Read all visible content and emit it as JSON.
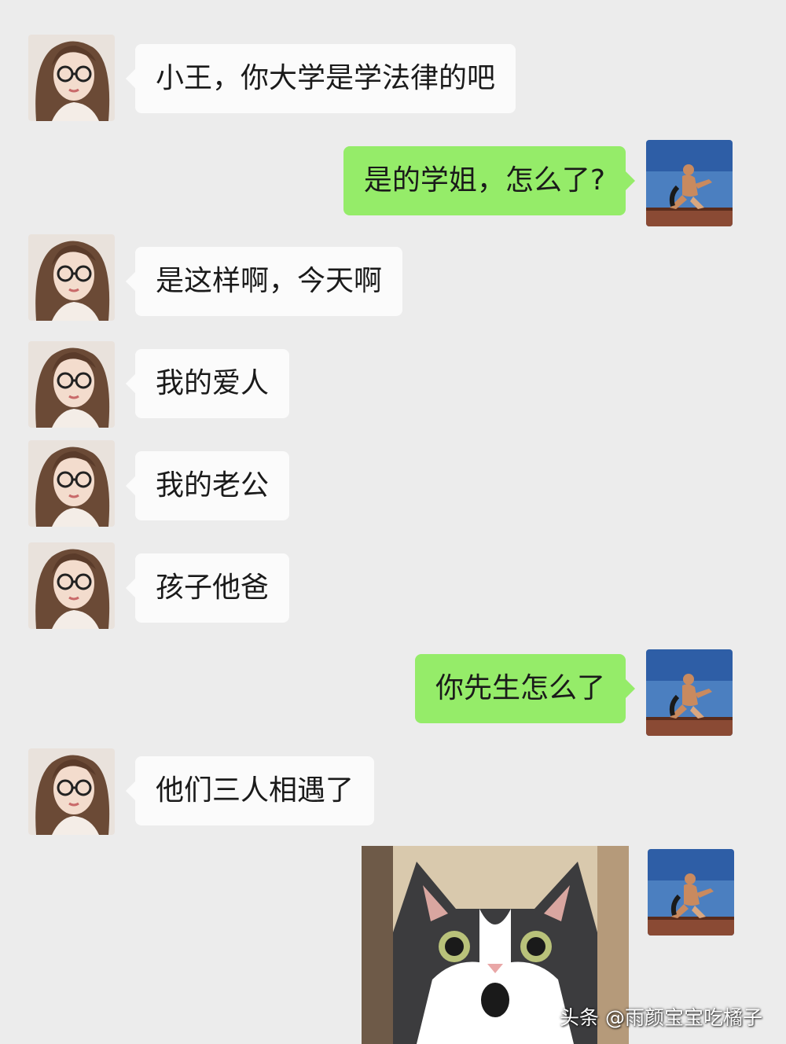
{
  "messages": [
    {
      "side": "in",
      "text": "小王，你大学是学法律的吧"
    },
    {
      "side": "out",
      "text": "是的学姐，怎么了?"
    },
    {
      "side": "in",
      "text": "是这样啊，今天啊"
    },
    {
      "side": "in",
      "text": "我的爱人"
    },
    {
      "side": "in",
      "text": "我的老公"
    },
    {
      "side": "in",
      "text": "孩子他爸"
    },
    {
      "side": "out",
      "text": "你先生怎么了"
    },
    {
      "side": "in",
      "text": "他们三人相遇了"
    },
    {
      "side": "out",
      "type": "sticker",
      "sticker_icon": "surprised-cat-sticker"
    }
  ],
  "avatars": {
    "in_icon": "woman-glasses-avatar-icon",
    "out_icon": "man-sitting-sky-avatar-icon"
  },
  "colors": {
    "background": "#ececec",
    "incoming_bubble": "#fbfbfb",
    "outgoing_bubble": "#95ec69"
  },
  "watermark": {
    "text": "头条 @雨颜宝宝吃橘子"
  }
}
